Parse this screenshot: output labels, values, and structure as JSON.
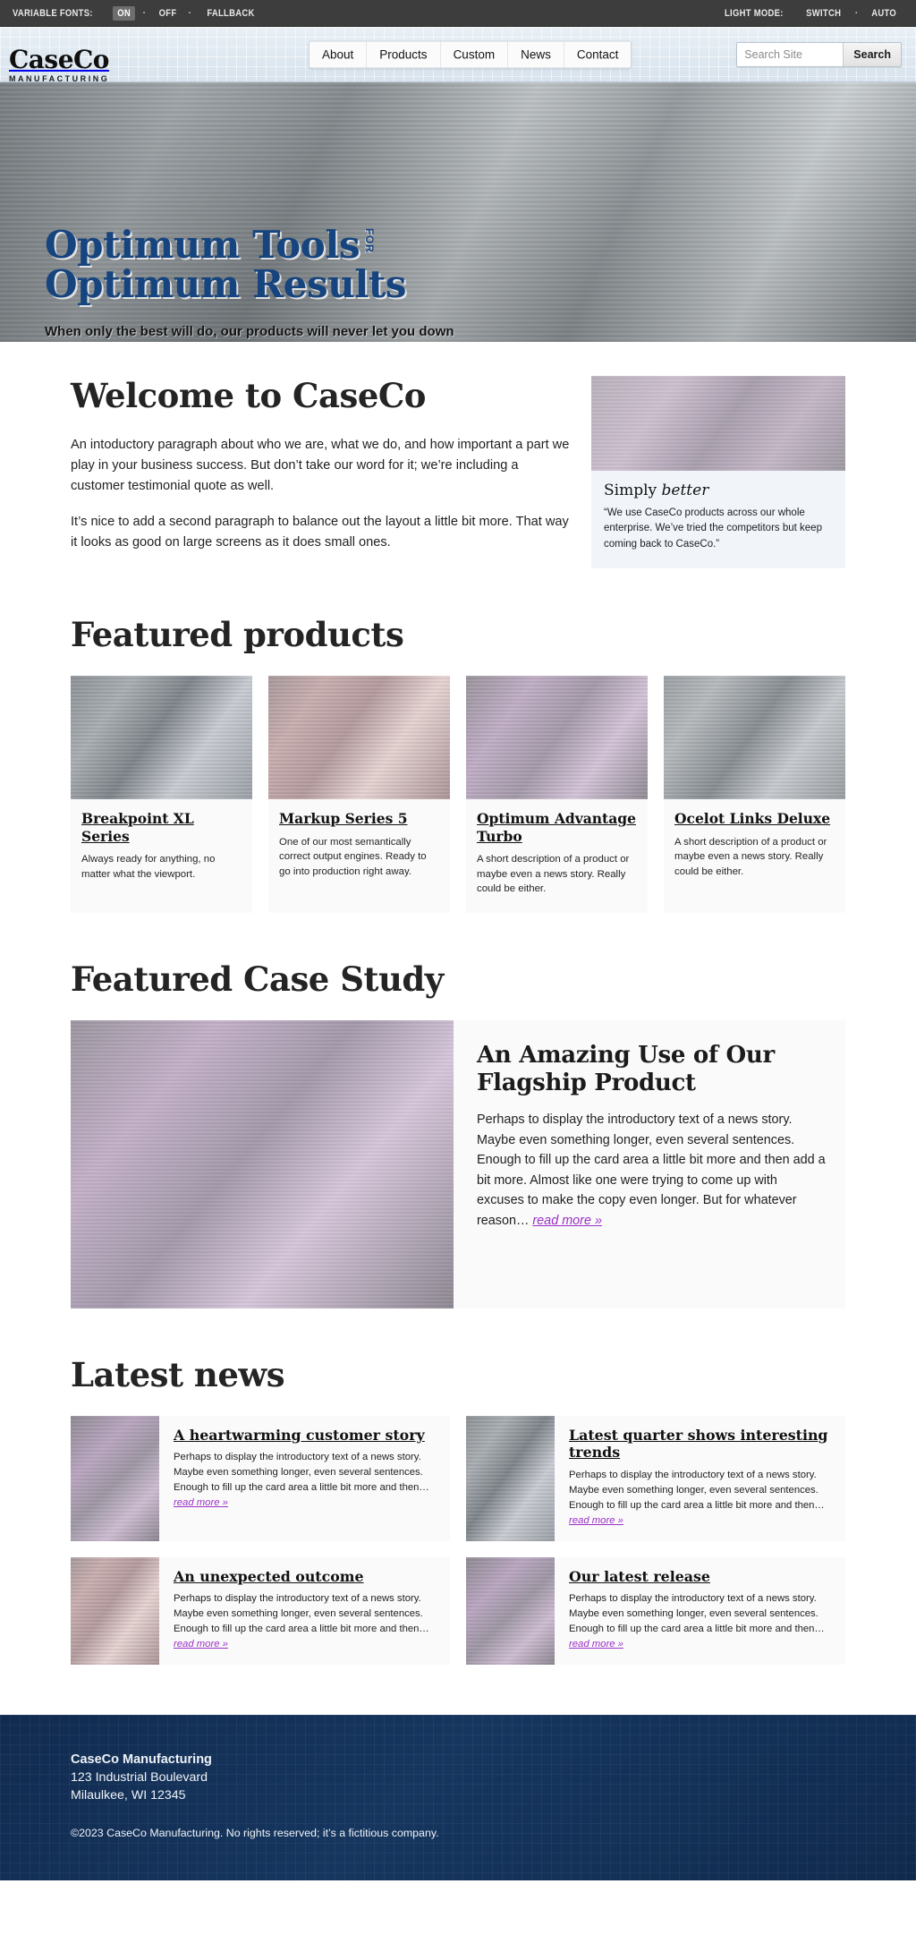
{
  "toolbar": {
    "variable_fonts_label": "VARIABLE FONTS:",
    "options": [
      {
        "label": "ON",
        "active": true
      },
      {
        "label": "OFF",
        "active": false
      },
      {
        "label": "FALLBACK",
        "active": false
      }
    ],
    "separator": "·",
    "light_mode_label": "LIGHT MODE:",
    "light_mode_options": [
      {
        "label": "SWITCH"
      },
      {
        "label": "AUTO"
      }
    ]
  },
  "header": {
    "brand_name": "CaseCo",
    "brand_sub": "MANUFACTURING",
    "nav": [
      {
        "label": "About"
      },
      {
        "label": "Products"
      },
      {
        "label": "Custom"
      },
      {
        "label": "News"
      },
      {
        "label": "Contact"
      }
    ],
    "search": {
      "placeholder": "Search Site",
      "value": "",
      "button_label": "Search"
    }
  },
  "hero": {
    "title_line1": "Optimum Tools",
    "title_for": "FOR",
    "title_line2": "Optimum Results",
    "subtitle": "When only the best will do, our products will never let you down",
    "title_color": "#16447e"
  },
  "welcome": {
    "heading": "Welcome to CaseCo",
    "paragraph1": "An intoductory paragraph about who we are, what we do, and how important a part we play in your business success. But don’t take our word for it; we’re including a customer testimonial quote as well.",
    "paragraph2": "It’s nice to add a second paragraph to balance out the layout a little bit more. That way it looks as good on large screens as it does small ones."
  },
  "testimonial": {
    "title_plain": "Simply ",
    "title_em": "better",
    "quote": "“We use CaseCo products across our whole enterprise. We’ve tried the competitors but keep coming back to CaseCo.”"
  },
  "featured": {
    "heading": "Featured products",
    "products": [
      {
        "title": "Breakpoint XL Series",
        "desc": "Always ready for anything, no matter what the viewport.",
        "thumb": "tx-gray"
      },
      {
        "title": "Markup Series 5",
        "desc": "One of our most semantically correct output engines. Ready to go into production right away.",
        "thumb": "tx-rose"
      },
      {
        "title": "Optimum Advantage Turbo",
        "desc": "A short description of a product or maybe even a news story. Really could be either.",
        "thumb": "tx-lilac"
      },
      {
        "title": "Ocelot Links Deluxe",
        "desc": "A short description of a product or maybe even a news story. Really could be either.",
        "thumb": "tx-steel"
      }
    ]
  },
  "case_study": {
    "heading": "Featured Case Study",
    "title": "An Amazing Use of Our Flagship Product",
    "text": "Perhaps to display the introductory text of a news story. Maybe even something longer, even several sentences. Enough to fill up the card area a little bit more and then add a bit more. Almost like one were trying to come up with excuses to make the copy even longer. But for whatever reason… ",
    "read_more": "read more »",
    "read_more_color": "#9b30c6"
  },
  "news": {
    "heading": "Latest news",
    "items": [
      {
        "title": "A heartwarming customer story",
        "text": "Perhaps to display the introductory text of a news story. Maybe even something longer, even several sentences. Enough to fill up the card area a little bit more and then… ",
        "read_more": "read more »",
        "thumb": "tx-plum"
      },
      {
        "title": "Latest quarter shows interesting trends",
        "text": "Perhaps to display the introductory text of a news story. Maybe even something longer, even several sentences. Enough to fill up the card area a little bit more and then… ",
        "read_more": "read more »",
        "thumb": "tx-gray"
      },
      {
        "title": "An unexpected outcome",
        "text": "Perhaps to display the introductory text of a news story. Maybe even something longer, even several sentences. Enough to fill up the card area a little bit more and then… ",
        "read_more": "read more »",
        "thumb": "tx-rose"
      },
      {
        "title": "Our latest release",
        "text": "Perhaps to display the introductory text of a news story. Maybe even something longer, even several sentences. Enough to fill up the card area a little bit more and then… ",
        "read_more": "read more »",
        "thumb": "tx-plum"
      }
    ]
  },
  "footer": {
    "org": "CaseCo Manufacturing",
    "address1": "123 Industrial Boulevard",
    "address2": "Milaulkee, WI 12345",
    "copyright": "©2023 CaseCo Manufacturing. No rights reserved; it’s a fictitious company.",
    "background": "#143057"
  }
}
